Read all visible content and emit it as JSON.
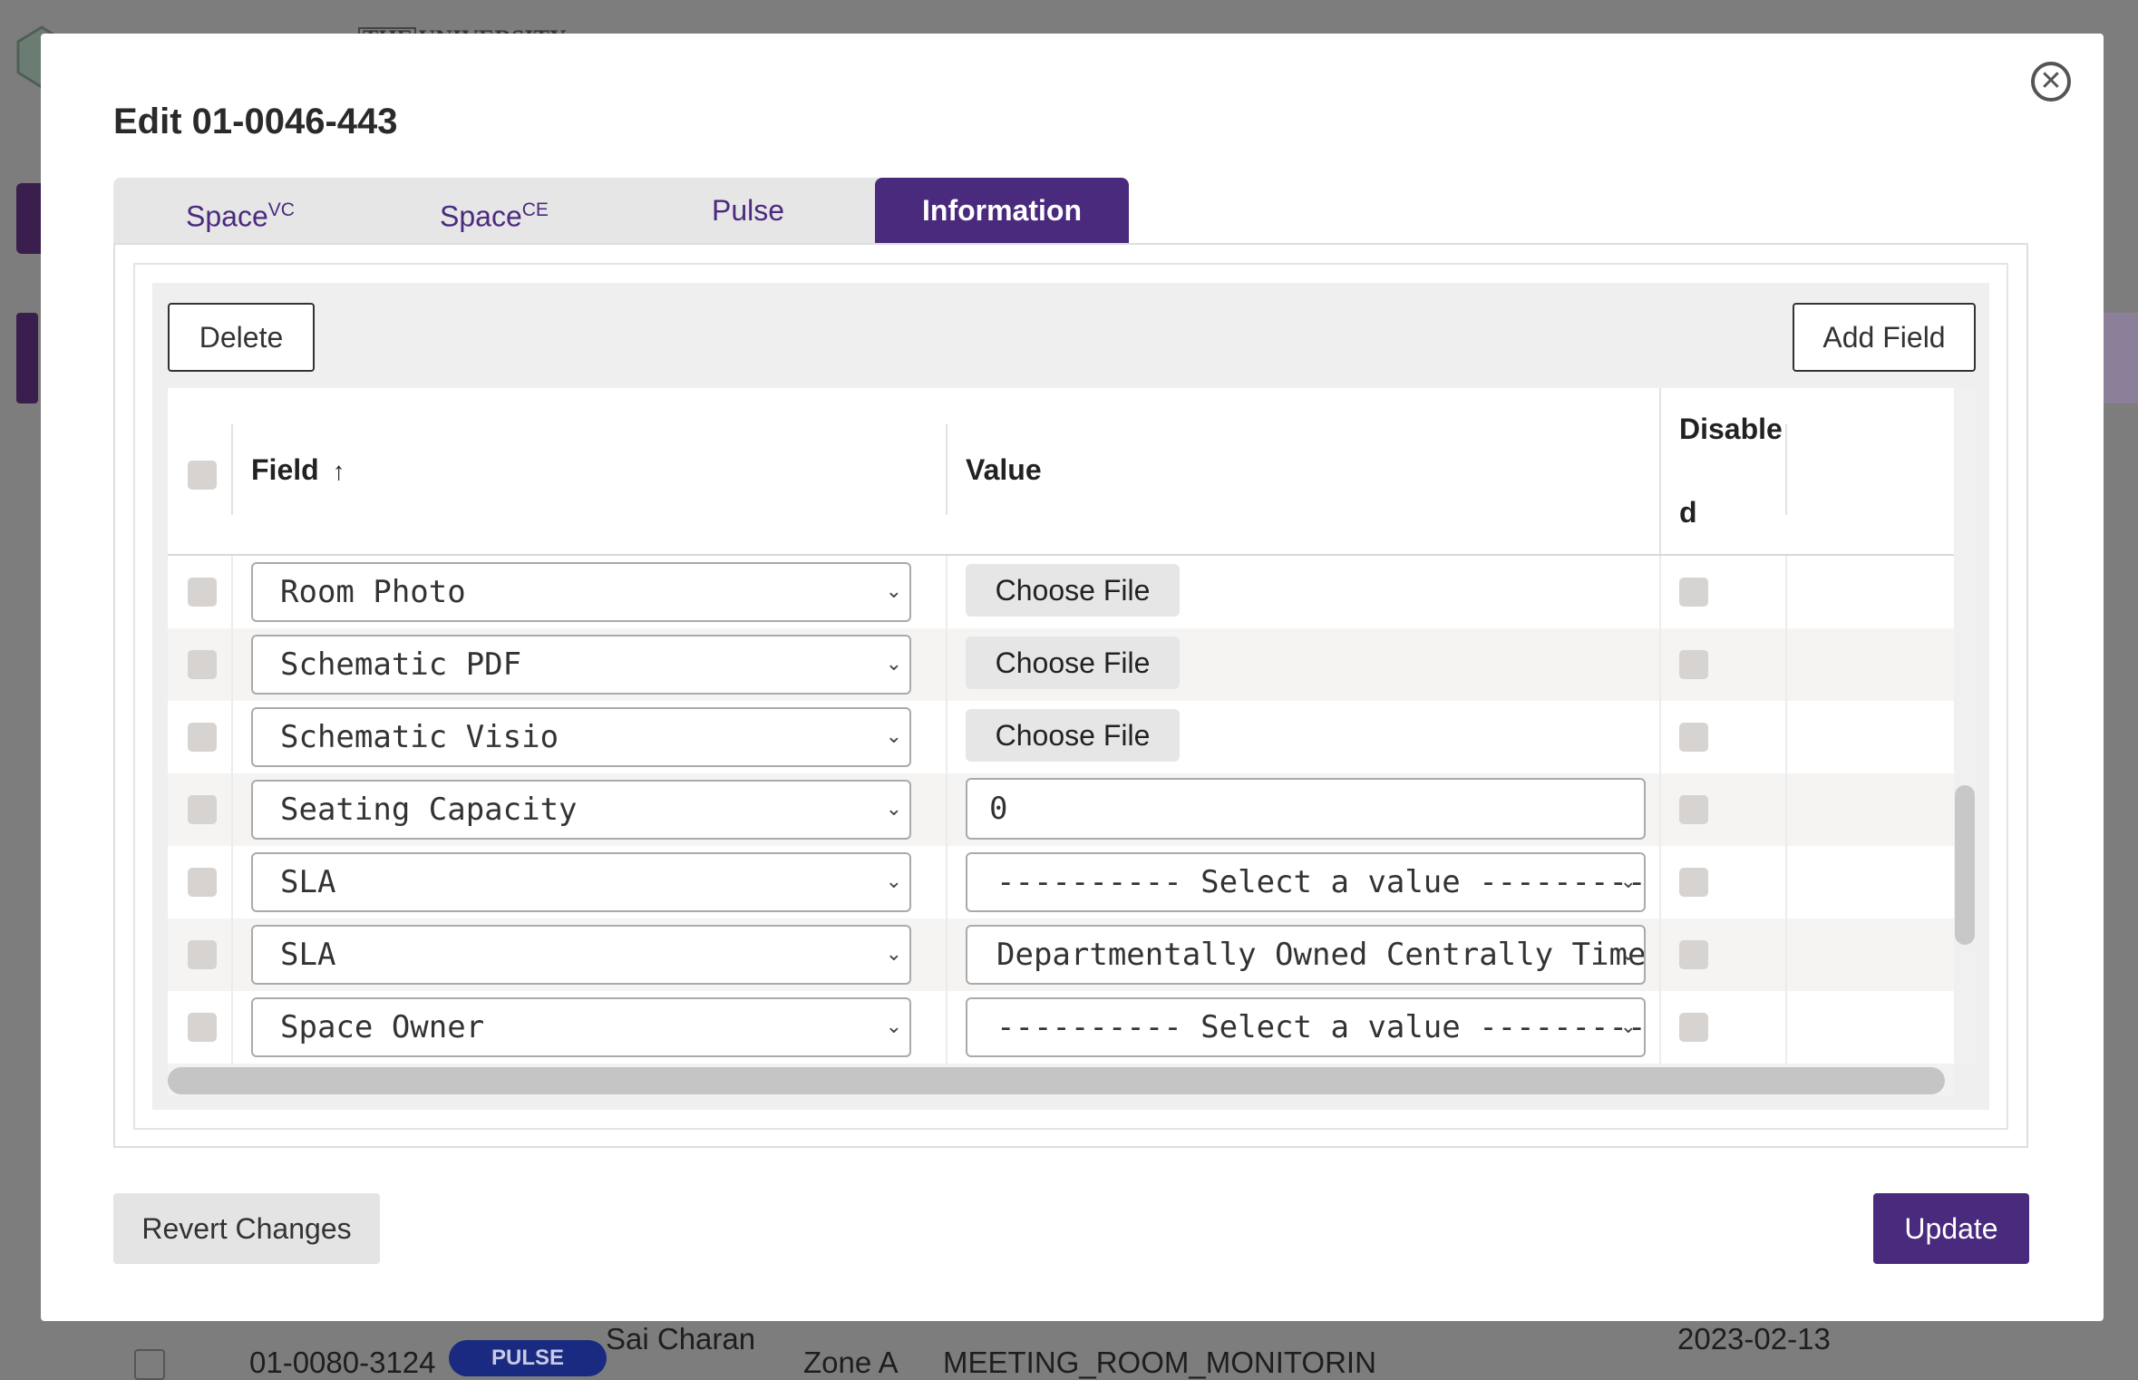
{
  "background": {
    "org_name": "THE UNIVERSITY",
    "row": {
      "id": "01-0080-3124",
      "badge": "PULSE",
      "person": "Sai Charan",
      "zone": "Zone A",
      "type": "MEETING_ROOM_MONITORIN",
      "date": "2023-02-13"
    }
  },
  "modal": {
    "title": "Edit 01-0046-443",
    "close_icon": "close-circle-icon",
    "tabs": [
      {
        "label": "Space",
        "sup": "VC",
        "active": false
      },
      {
        "label": "Space",
        "sup": "CE",
        "active": false
      },
      {
        "label": "Pulse",
        "sup": "",
        "active": false
      },
      {
        "label": "Information",
        "sup": "",
        "active": true
      }
    ],
    "toolbar": {
      "delete_label": "Delete",
      "add_field_label": "Add Field"
    },
    "table": {
      "headers": {
        "field": "Field",
        "value": "Value",
        "disabled_line1": "Disable",
        "disabled_line2": "d"
      },
      "sort_icon": "arrow-up-icon",
      "rows": [
        {
          "field": "Room Photo",
          "value_type": "file",
          "value": "Choose File"
        },
        {
          "field": "Schematic PDF",
          "value_type": "file",
          "value": "Choose File"
        },
        {
          "field": "Schematic Visio",
          "value_type": "file",
          "value": "Choose File"
        },
        {
          "field": "Seating Capacity",
          "value_type": "text",
          "value": "0"
        },
        {
          "field": "SLA",
          "value_type": "select",
          "value": "---------- Select a value ----------"
        },
        {
          "field": "SLA",
          "value_type": "select",
          "value": "Departmentally Owned Centrally Timetabled"
        },
        {
          "field": "Space Owner",
          "value_type": "select",
          "value": "---------- Select a value ----------"
        }
      ]
    },
    "footer": {
      "revert_label": "Revert Changes",
      "update_label": "Update"
    }
  },
  "colors": {
    "accent": "#4a2a7d",
    "overlay": "#7d7d7d"
  }
}
